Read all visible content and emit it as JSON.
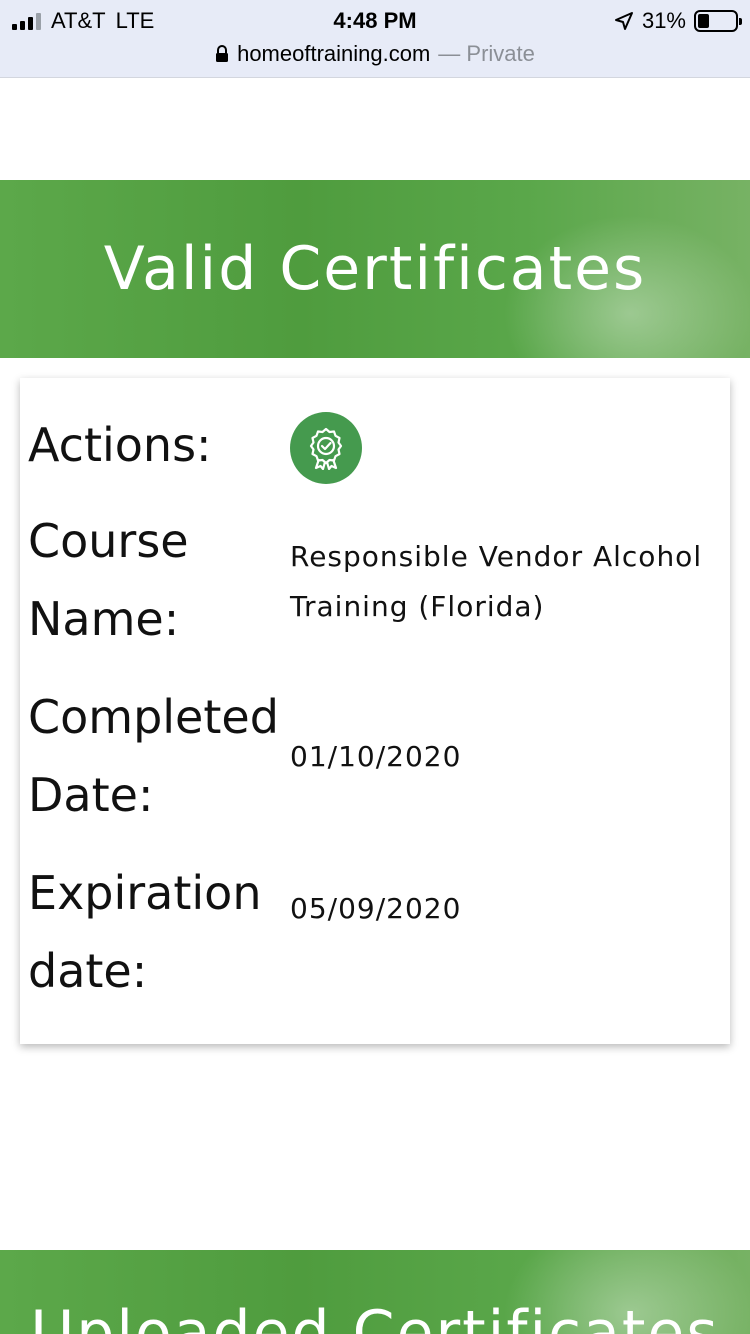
{
  "status_bar": {
    "carrier": "AT&T",
    "network": "LTE",
    "time": "4:48 PM",
    "battery_percent_text": "31%",
    "battery_level": 0.31
  },
  "url_bar": {
    "domain": "homeoftraining.com",
    "separator": " — ",
    "mode": "Private"
  },
  "valid_section": {
    "title": "Valid Certificates"
  },
  "certificate": {
    "actions_label": "Actions:",
    "action_icon": "certificate-award-icon",
    "course_label_line1": "Course",
    "course_label_line2": "Name:",
    "course_name_line1": "Responsible Vendor Alcohol",
    "course_name_line2": "Training (Florida)",
    "completed_label_line1": "Completed",
    "completed_label_line2": "Date:",
    "completed_date": "01/10/2020",
    "expiration_label_line1": "Expiration",
    "expiration_label_line2": "date:",
    "expiration_date": "05/09/2020"
  },
  "uploaded_section": {
    "title": "Uploaded Certificates"
  },
  "colors": {
    "banner_green": "#4f9c3e",
    "action_button_green": "#459a4e",
    "status_bar_bg": "#e7ebf7"
  }
}
